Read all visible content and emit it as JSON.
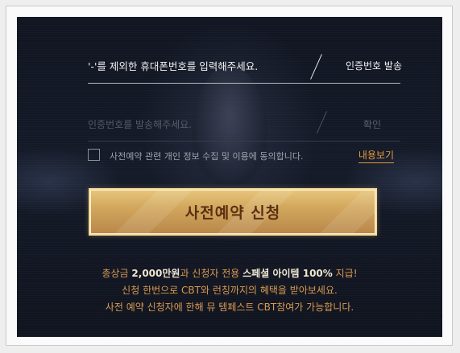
{
  "form": {
    "phone_placeholder": "'-'를 제외한 휴대폰번호를 입력해주세요.",
    "send_code_label": "인증번호 발송",
    "code_placeholder": "인증번호를 발송해주세요.",
    "confirm_label": "확인",
    "agree_label": "사전예약 관련 개인 정보 수집 및 이용에 동의합니다.",
    "details_label": "내용보기",
    "agree_checked": false,
    "apply_label": "사전예약 신청"
  },
  "info": {
    "line1_a": "총상금 ",
    "line1_b": "2,000만원",
    "line1_c": "과 신청자 전용 ",
    "line1_d": "스페셜 아이템 100%",
    "line1_e": " 지급!",
    "line2": "신청 한번으로 CBT와 런칭까지의 혜택을 받아보세요.",
    "line3": "사전 예약 신청자에 한해 뮤 템페스트 CBT참여가 가능합니다."
  },
  "colors": {
    "panel_bg": "#131826",
    "accent_orange": "#e59a3f",
    "button_gold": "#d2a75d",
    "button_text": "#5a2f12"
  }
}
